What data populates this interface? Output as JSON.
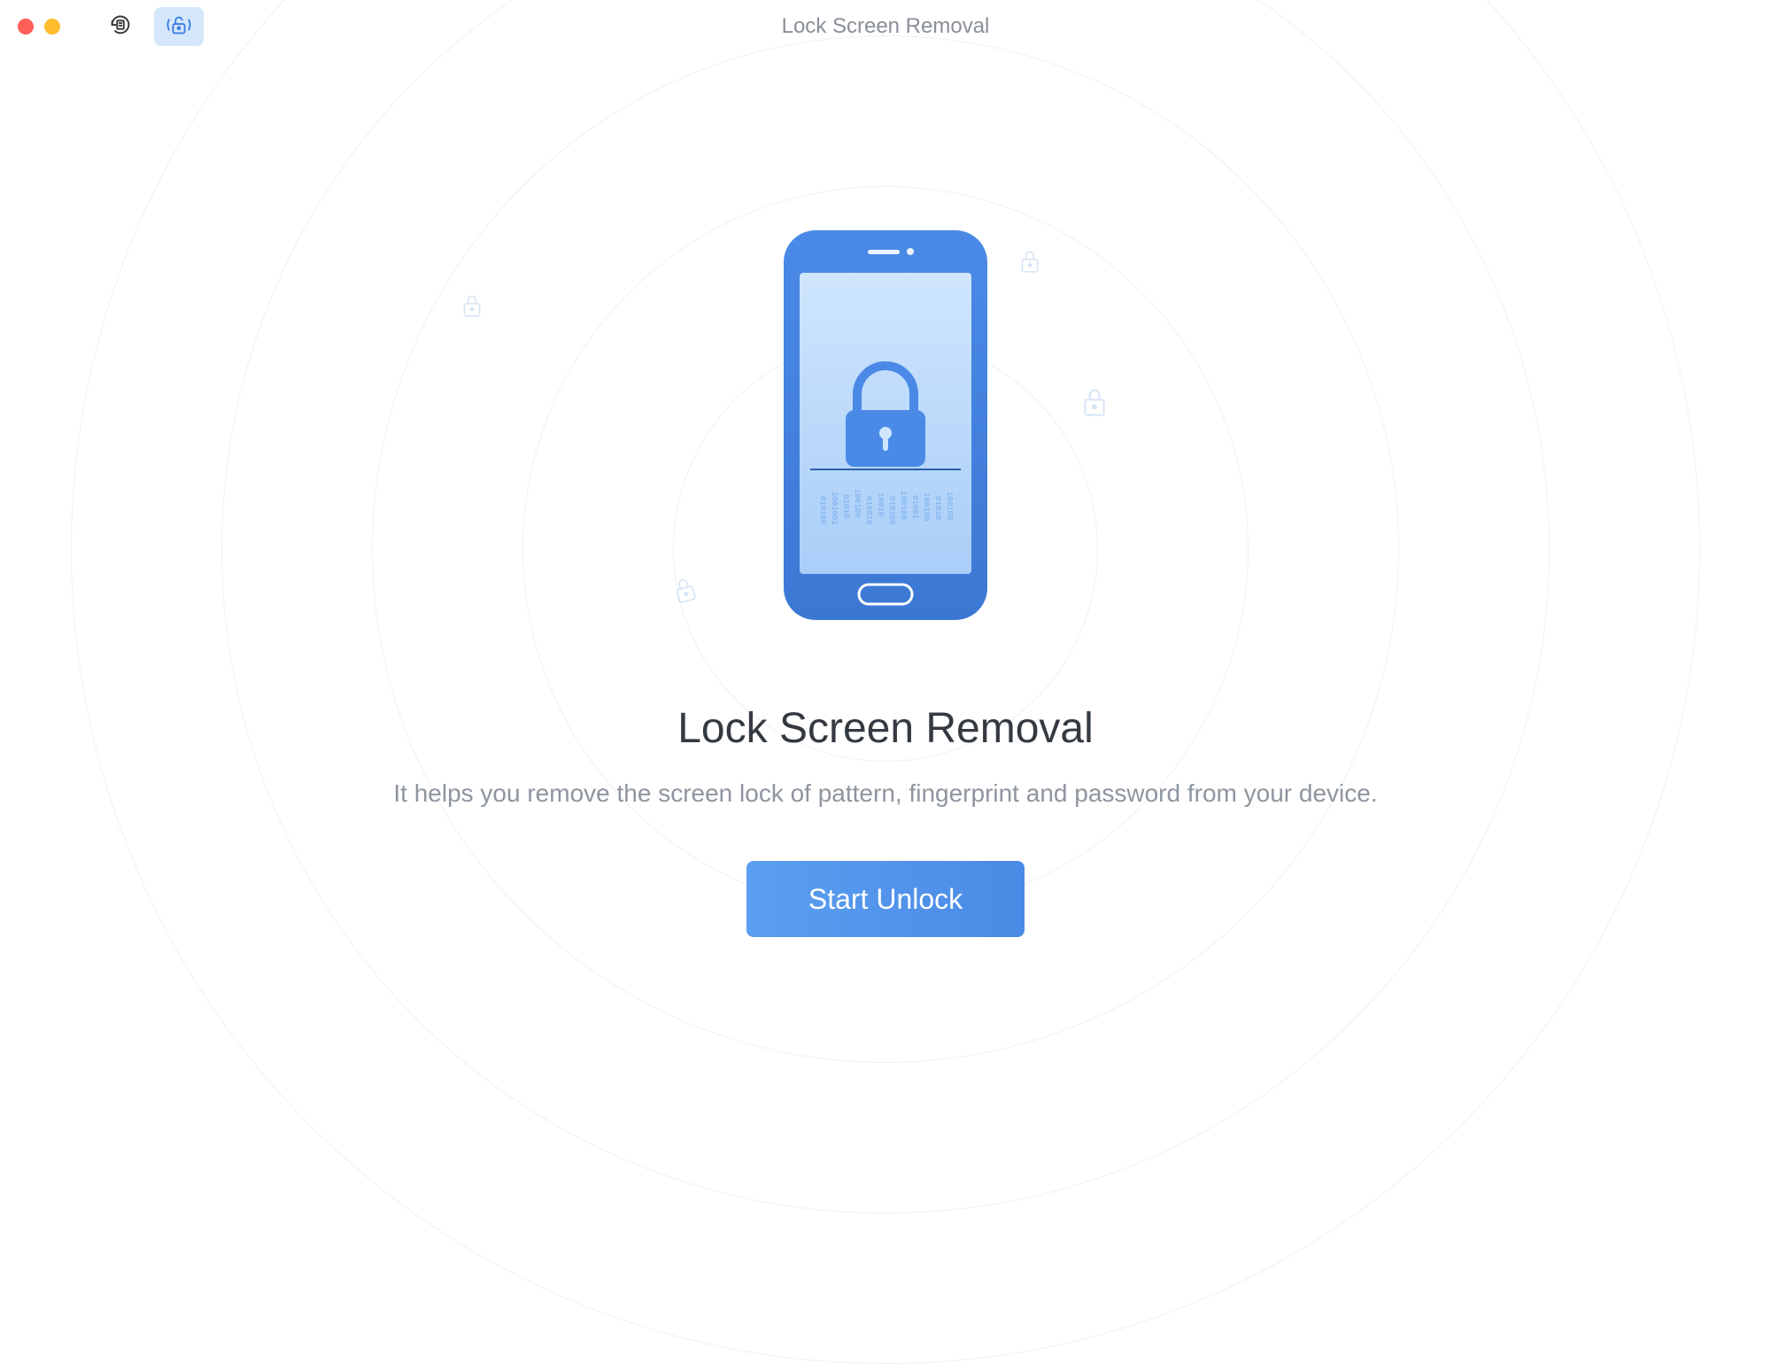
{
  "titlebar": {
    "title": "Lock Screen Removal"
  },
  "main": {
    "heading": "Lock Screen Removal",
    "subheading": "It helps you remove the screen lock of pattern, fingerprint and password from your device.",
    "start_button_label": "Start Unlock"
  },
  "icons": {
    "history": "history-icon",
    "unlock_mode": "unlock-mode-icon",
    "phone": "phone-illustration",
    "floating_locks": "lock-icon"
  },
  "colors": {
    "accent": "#4a8ae6",
    "accent_light": "#d5e7fb",
    "text_dark": "#343a40",
    "text_muted": "#8e959e",
    "ring": "#eef0f3"
  }
}
